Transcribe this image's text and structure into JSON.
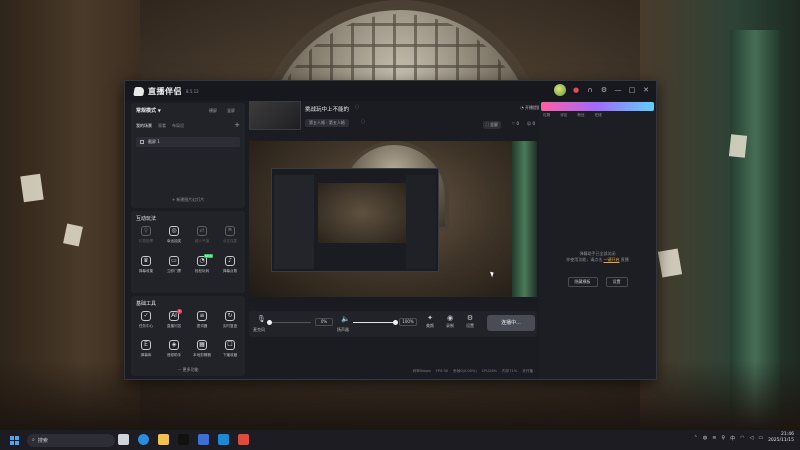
{
  "app": {
    "title": "直播伴侣",
    "version": "8.5.12",
    "scene_mode": "常规模式",
    "scene_actions": [
      "横屏",
      "竖屏"
    ],
    "scene_tabs": [
      "我的场景",
      "观看",
      "布局设"
    ],
    "scene_items": [
      "截屏 1"
    ],
    "add_scene_label": "新建图片幻灯片",
    "interact_title": "互动玩法",
    "interact_tools": [
      "礼物投票",
      "幸运抽奖",
      "超人气值",
      "点名连麦",
      "弹幕收集",
      "立即门票",
      "轻松玩转",
      "弹幕点歌"
    ],
    "basic_title": "基础工具",
    "basic_tools": [
      "任务中心",
      "直播问答",
      "提词器",
      "实时复盘",
      "弹幕库",
      "音频助手",
      "本地剪辑器",
      "下播收藏"
    ],
    "ai_badge": "AI",
    "new_badge": "NEW",
    "red_badge_count": "1",
    "more_label": "更多功能",
    "room_title": "挑战玩中上不能的",
    "room_tag": "第五人格 · 第五人格",
    "live_help": "开播提醒",
    "share": "分享",
    "fullscreen": "全屏",
    "likes": "0",
    "viewers": "0",
    "mic_label": "麦克风",
    "mic_pct": "0%",
    "mic_level": 0.0,
    "speaker_label": "扬声器",
    "speaker_pct": "100%",
    "speaker_level": 1.0,
    "buttons": [
      "美颜",
      "录制",
      "设置"
    ],
    "go_live": "连播中...",
    "status": [
      "码率0kbps",
      "FPS:30",
      "丢帧0(0.00%)",
      "CPU26%",
      "内存71%",
      "未开播"
    ],
    "right_tabs": [
      "礼物",
      "评论",
      "粉丝",
      "在线"
    ],
    "right_msg_1": "弹幕助手已全部关闭",
    "right_msg_2": "你使用功能，请点击",
    "right_msg_link": "一键开启",
    "right_msg_3": "直播",
    "right_btns": [
      "隐藏横板",
      "设置"
    ]
  },
  "taskbar": {
    "search": "搜索",
    "time": "21:46",
    "date": "2025/11/15",
    "ime": "中"
  },
  "colors": {
    "accent_warn": "#e3a53b",
    "new_green": "#3bbf6b",
    "alert_red": "#e64a5a"
  }
}
